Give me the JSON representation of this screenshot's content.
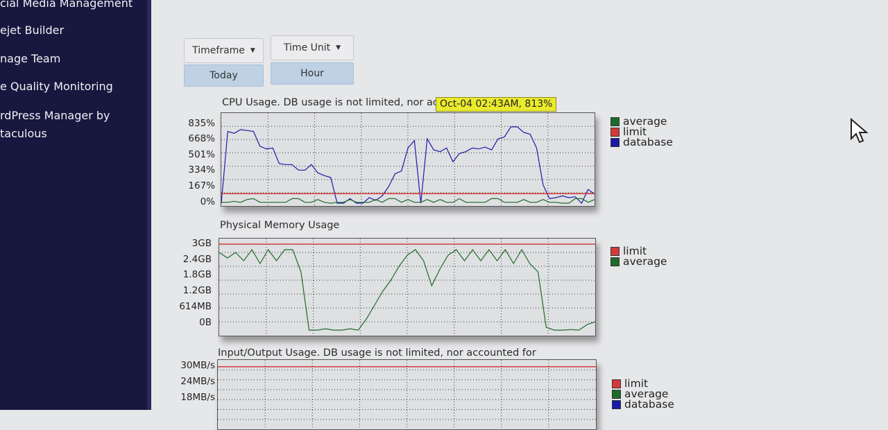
{
  "sidebar": {
    "items": [
      {
        "label": "cial Media Management"
      },
      {
        "label": "ejet Builder"
      },
      {
        "label": "nage Team"
      },
      {
        "label": "e Quality Monitoring"
      },
      {
        "label": "rdPress Manager by"
      },
      {
        "label": "taculous"
      }
    ]
  },
  "controls": {
    "timeframe": "Timeframe",
    "time_unit": "Time Unit",
    "today": "Today",
    "hour": "Hour"
  },
  "tooltip": "Oct-04 02:43AM, 813%",
  "colors": {
    "average": "#1e6b2a",
    "limit": "#d43a3a",
    "database": "#1a1aa8"
  },
  "chart_data": [
    {
      "type": "line",
      "title": "CPU Usage. DB usage is not limited, nor accounted for",
      "yticks": [
        "835%",
        "668%",
        "501%",
        "334%",
        "167%",
        "0%"
      ],
      "ylim": [
        0,
        950
      ],
      "legend": [
        "average",
        "limit",
        "database"
      ],
      "series": [
        {
          "name": "database",
          "values": [
            0,
            780,
            760,
            800,
            790,
            780,
            620,
            590,
            600,
            430,
            420,
            420,
            360,
            360,
            420,
            330,
            300,
            280,
            0,
            0,
            50,
            0,
            0,
            60,
            30,
            80,
            180,
            320,
            350,
            600,
            680,
            0,
            700,
            580,
            560,
            600,
            450,
            540,
            560,
            600,
            590,
            610,
            580,
            700,
            720,
            830,
            830,
            770,
            750,
            600,
            200,
            50,
            60,
            80,
            60,
            70,
            0,
            150,
            100
          ]
        },
        {
          "name": "limit",
          "values": [
            104,
            104
          ]
        },
        {
          "name": "average",
          "values": [
            10,
            10,
            20,
            10,
            40,
            50,
            10,
            10,
            10,
            10,
            10,
            50,
            50,
            10,
            10,
            40,
            10,
            0,
            10,
            10,
            40,
            10,
            10,
            10,
            40,
            10,
            50,
            50,
            10,
            40,
            10,
            10,
            40,
            10,
            40,
            10,
            10,
            50,
            10,
            10,
            10,
            10,
            50,
            50,
            10,
            10,
            10,
            40,
            10,
            10,
            40,
            10,
            10,
            0,
            0,
            50,
            50,
            10,
            40
          ]
        }
      ]
    },
    {
      "type": "line",
      "title": "Physical Memory Usage",
      "yticks": [
        "3GB",
        "2.4GB",
        "1.8GB",
        "1.2GB",
        "614MB",
        "0B"
      ],
      "ylim": [
        0,
        3.3
      ],
      "legend": [
        "limit",
        "average"
      ],
      "series": [
        {
          "name": "limit",
          "values": [
            3.2,
            3.2
          ]
        },
        {
          "name": "average",
          "values": [
            2.9,
            2.7,
            2.9,
            2.6,
            3.0,
            2.5,
            3.0,
            2.6,
            3.0,
            3.0,
            2.2,
            0.1,
            0.1,
            0.15,
            0.1,
            0.1,
            0.15,
            0.1,
            0.5,
            1.0,
            1.5,
            1.9,
            2.4,
            2.8,
            3.0,
            2.6,
            1.7,
            2.3,
            2.8,
            3.0,
            2.6,
            3.0,
            2.6,
            3.0,
            2.6,
            3.0,
            2.5,
            3.0,
            2.5,
            2.2,
            0.2,
            0.1,
            0.1,
            0.12,
            0.1,
            0.3,
            0.4
          ]
        }
      ]
    },
    {
      "type": "line",
      "title": "Input/Output Usage. DB usage is not limited, nor accounted for",
      "yticks": [
        "30MB/s",
        "24MB/s",
        "18MB/s"
      ],
      "ylim": [
        0,
        32
      ],
      "legend": [
        "limit",
        "average",
        "database"
      ],
      "series": [
        {
          "name": "limit",
          "values": [
            30,
            30
          ]
        }
      ]
    }
  ]
}
